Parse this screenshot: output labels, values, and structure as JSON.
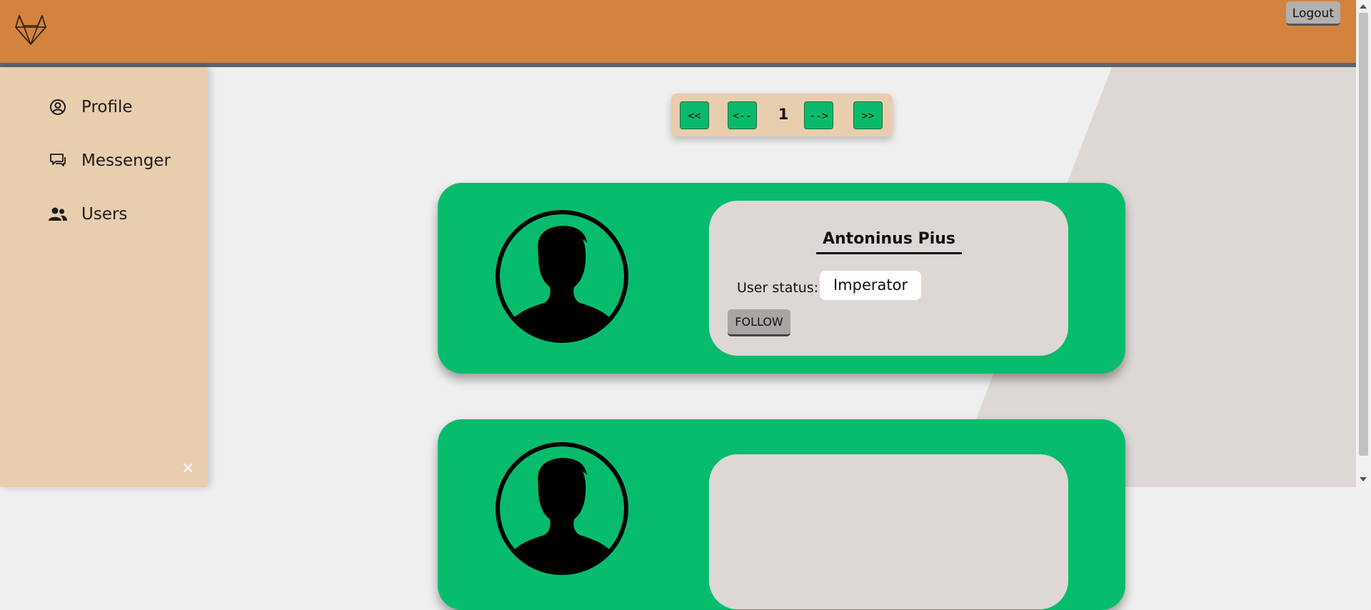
{
  "header": {
    "logo_icon": "fox-logo-icon",
    "logout_label": "Logout",
    "background_color": "#d4823f"
  },
  "sidebar": {
    "items": [
      {
        "label": "Profile",
        "icon": "user-circle-icon"
      },
      {
        "label": "Messenger",
        "icon": "chat-icon"
      },
      {
        "label": "Users",
        "icon": "users-icon"
      }
    ],
    "close_label": "×",
    "background_color": "#e9cdaf"
  },
  "pagination": {
    "first_label": "<<",
    "prev_label": "<--",
    "current_page": "1",
    "next_label": "-->",
    "last_label": ">>"
  },
  "users": [
    {
      "name": "Antoninus Pius",
      "status_label": "User status:",
      "status": "Imperator",
      "follow_label": "FOLLOW",
      "avatar_icon": "user-silhouette-icon"
    },
    {
      "name": "",
      "status_label": "",
      "status": "",
      "follow_label": "",
      "avatar_icon": "user-silhouette-icon"
    }
  ],
  "colors": {
    "accent_green": "#07bc6c",
    "panel_gray": "#ddd8d5"
  }
}
